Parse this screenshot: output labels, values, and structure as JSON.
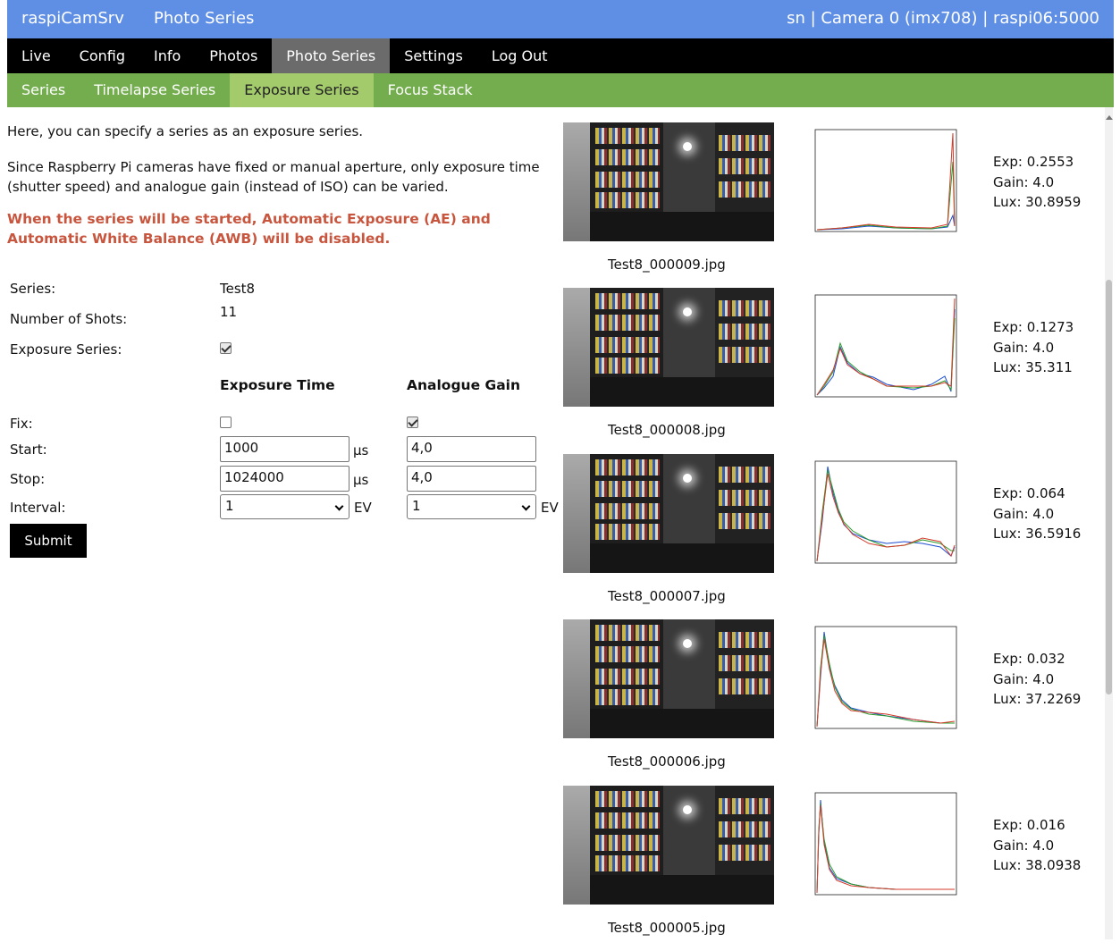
{
  "topbar": {
    "brand": "raspiCamSrv",
    "page": "Photo Series",
    "status": "sn | Camera 0 (imx708) | raspi06:5000"
  },
  "mainnav": [
    "Live",
    "Config",
    "Info",
    "Photos",
    "Photo Series",
    "Settings",
    "Log Out"
  ],
  "subnav": [
    "Series",
    "Timelapse Series",
    "Exposure Series",
    "Focus Stack"
  ],
  "intro": "Here, you can specify a series as an exposure series.",
  "intro2": "Since Raspberry Pi cameras have fixed or manual aperture, only exposure time (shutter speed) and analogue gain (instead of ISO) can be varied.",
  "warning": "When the series will be started, Automatic Exposure (AE) and Automatic White Balance (AWB) will be disabled.",
  "form": {
    "series_label": "Series:",
    "series_value": "Test8",
    "shots_label": "Number of Shots:",
    "shots_value": "11",
    "expseries_label": "Exposure Series:",
    "expseries_checked": true,
    "col_exposure": "Exposure Time",
    "col_gain": "Analogue Gain",
    "fix_label": "Fix:",
    "fix_exposure_checked": false,
    "fix_gain_checked": true,
    "start_label": "Start:",
    "start_exposure": "1000",
    "start_gain": "4,0",
    "stop_label": "Stop:",
    "stop_exposure": "1024000",
    "stop_gain": "4,0",
    "interval_label": "Interval:",
    "interval_exposure": "1",
    "interval_gain": "1",
    "unit_us": "µs",
    "unit_ev": "EV",
    "submit": "Submit"
  },
  "photos": [
    {
      "file": "Test8_000009.jpg",
      "exp": "Exp: 0.2553",
      "gain": "Gain: 4.0",
      "lux": "Lux: 30.8959"
    },
    {
      "file": "Test8_000008.jpg",
      "exp": "Exp: 0.1273",
      "gain": "Gain: 4.0",
      "lux": "Lux: 35.311"
    },
    {
      "file": "Test8_000007.jpg",
      "exp": "Exp: 0.064",
      "gain": "Gain: 4.0",
      "lux": "Lux: 36.5916"
    },
    {
      "file": "Test8_000006.jpg",
      "exp": "Exp: 0.032",
      "gain": "Gain: 4.0",
      "lux": "Lux: 37.2269"
    },
    {
      "file": "Test8_000005.jpg",
      "exp": "Exp: 0.016",
      "gain": "Gain: 4.0",
      "lux": "Lux: 38.0938"
    }
  ],
  "colors": {
    "topbar": "#5f8fe5",
    "mainnav": "#000000",
    "subnav": "#73ad4e",
    "subnav_active": "#a3cb6c",
    "warning": "#c8553d"
  }
}
